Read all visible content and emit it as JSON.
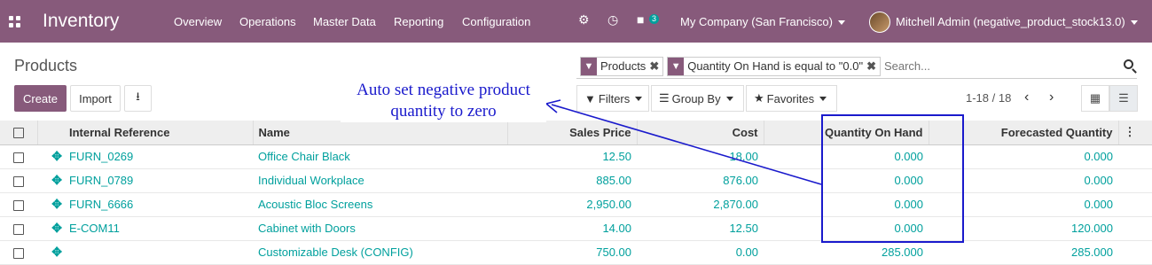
{
  "nav": {
    "app_title": "Inventory",
    "menu": [
      "Overview",
      "Operations",
      "Master Data",
      "Reporting",
      "Configuration"
    ],
    "messages_count": "3",
    "company": "My Company (San Francisco)",
    "user": "Mitchell Admin (negative_product_stock13.0)"
  },
  "page": {
    "title": "Products",
    "create_label": "Create",
    "import_label": "Import"
  },
  "search": {
    "facets": [
      "Products",
      "Quantity On Hand is equal to \"0.0\""
    ],
    "placeholder": "Search..."
  },
  "controls": {
    "filters": "Filters",
    "group_by": "Group By",
    "favorites": "Favorites",
    "pager": "1-18 / 18"
  },
  "table": {
    "headers": [
      "Internal Reference",
      "Name",
      "Sales Price",
      "Cost",
      "Quantity On Hand",
      "Forecasted Quantity"
    ],
    "rows": [
      {
        "ref": "FURN_0269",
        "name": "Office Chair Black",
        "price": "12.50",
        "cost": "18.00",
        "qty": "0.000",
        "forecast": "0.000"
      },
      {
        "ref": "FURN_0789",
        "name": "Individual Workplace",
        "price": "885.00",
        "cost": "876.00",
        "qty": "0.000",
        "forecast": "0.000"
      },
      {
        "ref": "FURN_6666",
        "name": "Acoustic Bloc Screens",
        "price": "2,950.00",
        "cost": "2,870.00",
        "qty": "0.000",
        "forecast": "0.000"
      },
      {
        "ref": "E-COM11",
        "name": "Cabinet with Doors",
        "price": "14.00",
        "cost": "12.50",
        "qty": "0.000",
        "forecast": "120.000"
      },
      {
        "ref": "",
        "name": "Customizable Desk (CONFIG)",
        "price": "750.00",
        "cost": "0.00",
        "qty": "285.000",
        "forecast": "285.000"
      }
    ]
  },
  "annotation": {
    "line1": "Auto set negative product",
    "line2": "quantity to zero"
  },
  "colors": {
    "brand": "#875a7b",
    "link": "#00a09d",
    "annotation": "#1a1acc"
  }
}
